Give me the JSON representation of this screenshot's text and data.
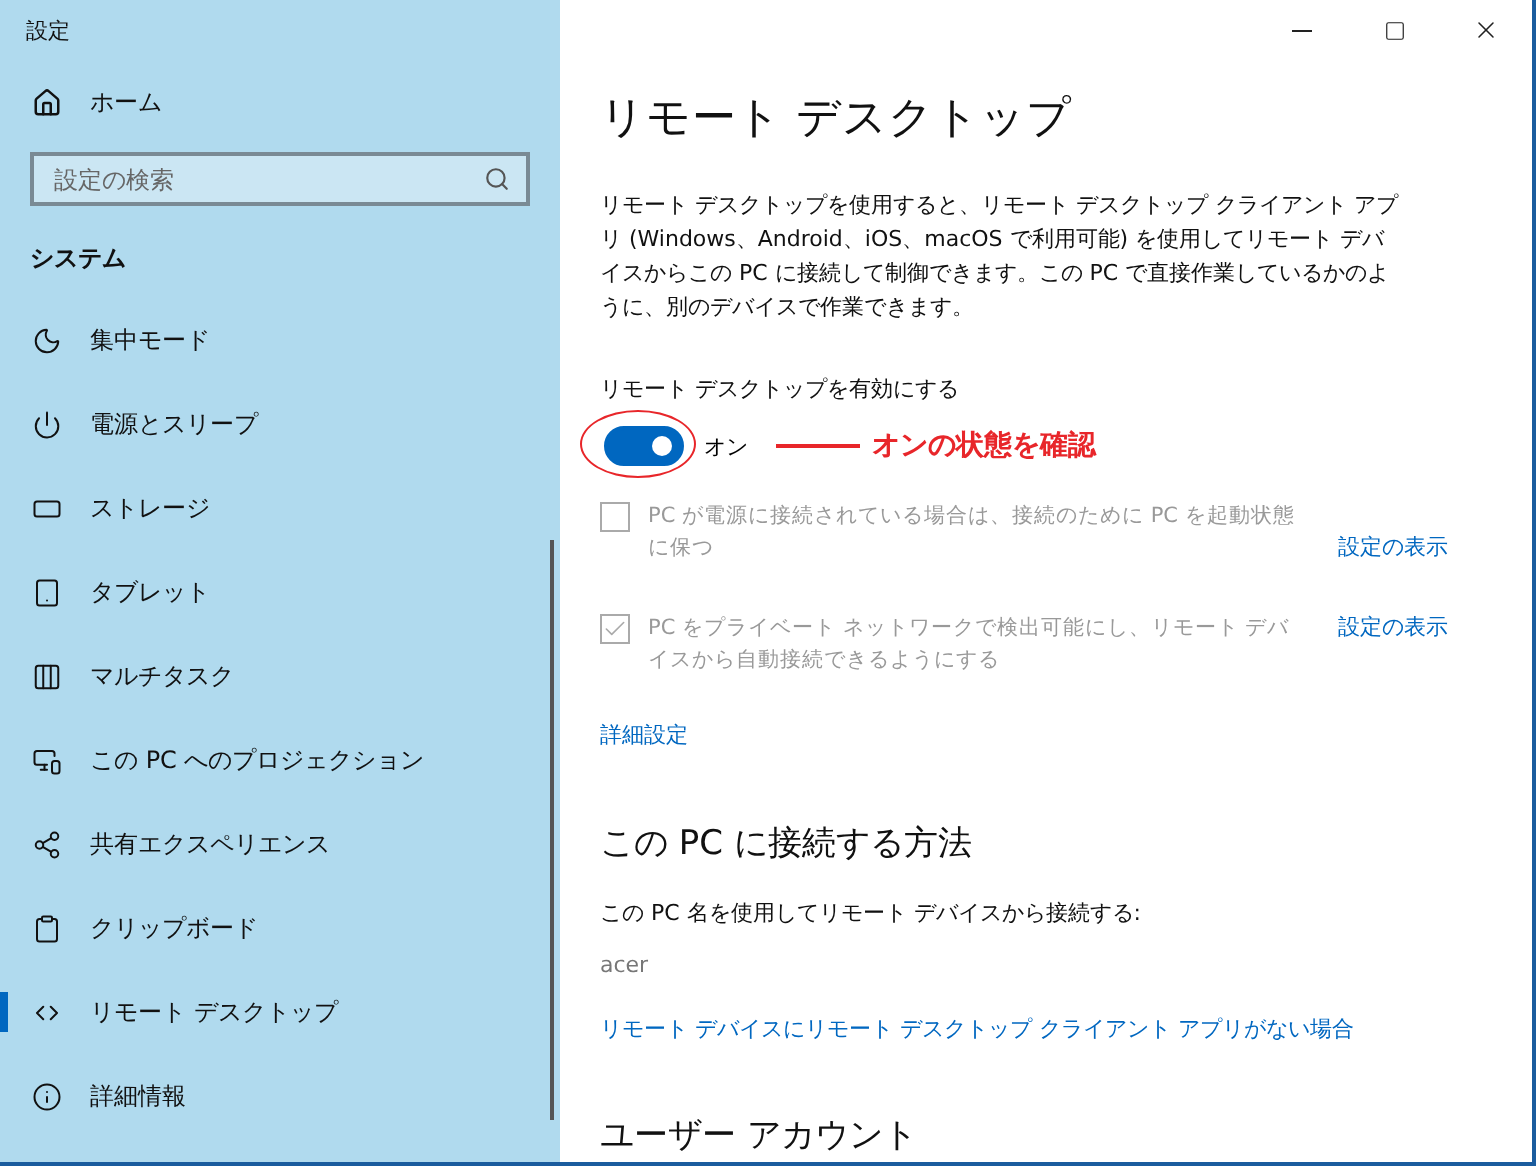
{
  "window": {
    "title": "設定"
  },
  "sidebar": {
    "home": "ホーム",
    "search": {
      "placeholder": "設定の検索"
    },
    "section": "システム",
    "items": [
      {
        "label": "集中モード",
        "kind": "moon",
        "selected": false
      },
      {
        "label": "電源とスリープ",
        "kind": "power",
        "selected": false
      },
      {
        "label": "ストレージ",
        "kind": "storage",
        "selected": false
      },
      {
        "label": "タブレット",
        "kind": "tablet",
        "selected": false
      },
      {
        "label": "マルチタスク",
        "kind": "multitask",
        "selected": false
      },
      {
        "label": "この PC へのプロジェクション",
        "kind": "projection",
        "selected": false
      },
      {
        "label": "共有エクスペリエンス",
        "kind": "share",
        "selected": false
      },
      {
        "label": "クリップボード",
        "kind": "clipboard",
        "selected": false
      },
      {
        "label": "リモート デスクトップ",
        "kind": "remote",
        "selected": true
      },
      {
        "label": "詳細情報",
        "kind": "info",
        "selected": false
      }
    ]
  },
  "page": {
    "title": "リモート デスクトップ",
    "description": "リモート デスクトップを使用すると、リモート デスクトップ クライアント アプリ (Windows、Android、iOS、macOS で利用可能) を使用してリモート デバイスからこの PC に接続して制御できます。この PC で直接作業しているかのように、別のデバイスで作業できます。",
    "toggle": {
      "label": "リモート デスクトップを有効にする",
      "on": true,
      "state_text": "オン"
    },
    "annotation": "オンの状態を確認",
    "options": [
      {
        "label": "PC が電源に接続されている場合は、接続のために PC を起動状態に保つ",
        "checked": false,
        "disabled": true,
        "link": "設定の表示"
      },
      {
        "label": "PC をプライベート ネットワークで検出可能にし、リモート デバイスから自動接続できるようにする",
        "checked": true,
        "disabled": true,
        "link": "設定の表示"
      }
    ],
    "advanced_link": "詳細設定",
    "connect": {
      "heading": "この PC に接続する方法",
      "text": "この PC 名を使用してリモート デバイスから接続する:",
      "pc_name": "acer",
      "link": "リモート デバイスにリモート デスクトップ クライアント アプリがない場合"
    },
    "next_heading": "ユーザー アカウント"
  }
}
